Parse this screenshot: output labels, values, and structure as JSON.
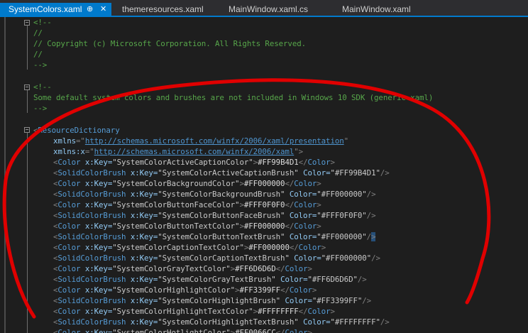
{
  "tabs": [
    {
      "label": "SystemColors.xaml",
      "active": true,
      "pin": "⊕",
      "close": "✕"
    },
    {
      "label": "themeresources.xaml",
      "active": false
    },
    {
      "label": "MainWindow.xaml.cs",
      "active": false
    },
    {
      "label": "MainWindow.xaml",
      "active": false
    }
  ],
  "code": {
    "l1": "<!--",
    "l2": "//",
    "l3": "// Copyright (c) Microsoft Corporation. All Rights Reserved.",
    "l4": "//",
    "l5": "-->",
    "l7": "<!--",
    "l8": "Some default system colors and brushes are not included in Windows 10 SDK (generic.xaml)",
    "l9": "-->",
    "rd_open": "<",
    "rd_name": "ResourceDictionary",
    "xmlns_attr": "xmlns",
    "xmlns_eq": "=\"",
    "xmlns_url": "http://schemas.microsoft.com/winfx/2006/xaml/presentation",
    "xmlns_close": "\"",
    "xmlnsx_attr": "xmlns:x",
    "xmlnsx_eq": "=\"",
    "xmlnsx_url": "http://schemas.microsoft.com/winfx/2006/xaml",
    "xmlnsx_close": "\">"
  },
  "entries": [
    {
      "kind": "Color",
      "key": "SystemColorActiveCaptionColor",
      "value": "#FF99B4D1"
    },
    {
      "kind": "SolidColorBrush",
      "key": "SystemColorActiveCaptionBrush",
      "value": "#FF99B4D1"
    },
    {
      "kind": "Color",
      "key": "SystemColorBackgroundColor",
      "value": "#FF000000"
    },
    {
      "kind": "SolidColorBrush",
      "key": "SystemColorBackgroundBrush",
      "value": "#FF000000"
    },
    {
      "kind": "Color",
      "key": "SystemColorButtonFaceColor",
      "value": "#FFF0F0F0"
    },
    {
      "kind": "SolidColorBrush",
      "key": "SystemColorButtonFaceBrush",
      "value": "#FFF0F0F0"
    },
    {
      "kind": "Color",
      "key": "SystemColorButtonTextColor",
      "value": "#FF000000"
    },
    {
      "kind": "SolidColorBrush",
      "key": "SystemColorButtonTextBrush",
      "value": "#FF000000"
    },
    {
      "kind": "Color",
      "key": "SystemColorCaptionTextColor",
      "value": "#FF000000"
    },
    {
      "kind": "SolidColorBrush",
      "key": "SystemColorCaptionTextBrush",
      "value": "#FF000000"
    },
    {
      "kind": "Color",
      "key": "SystemColorGrayTextColor",
      "value": "#FF6D6D6D"
    },
    {
      "kind": "SolidColorBrush",
      "key": "SystemColorGrayTextBrush",
      "value": "#FF6D6D6D"
    },
    {
      "kind": "Color",
      "key": "SystemColorHighlightColor",
      "value": "#FF3399FF"
    },
    {
      "kind": "SolidColorBrush",
      "key": "SystemColorHighlightBrush",
      "value": "#FF3399FF"
    },
    {
      "kind": "Color",
      "key": "SystemColorHighlightTextColor",
      "value": "#FFFFFFFF"
    },
    {
      "kind": "SolidColorBrush",
      "key": "SystemColorHighlightTextBrush",
      "value": "#FFFFFFFF"
    },
    {
      "kind": "Color",
      "key": "SystemColorHotlightColor",
      "value": "#FF0066CC"
    }
  ],
  "syntax": {
    "color_key_attr": "x:Key=",
    "color_attr": "Color=",
    "color_close_tag": "Color"
  },
  "colors": {
    "accent": "#007acc",
    "annotation_stroke": "#e00000"
  }
}
